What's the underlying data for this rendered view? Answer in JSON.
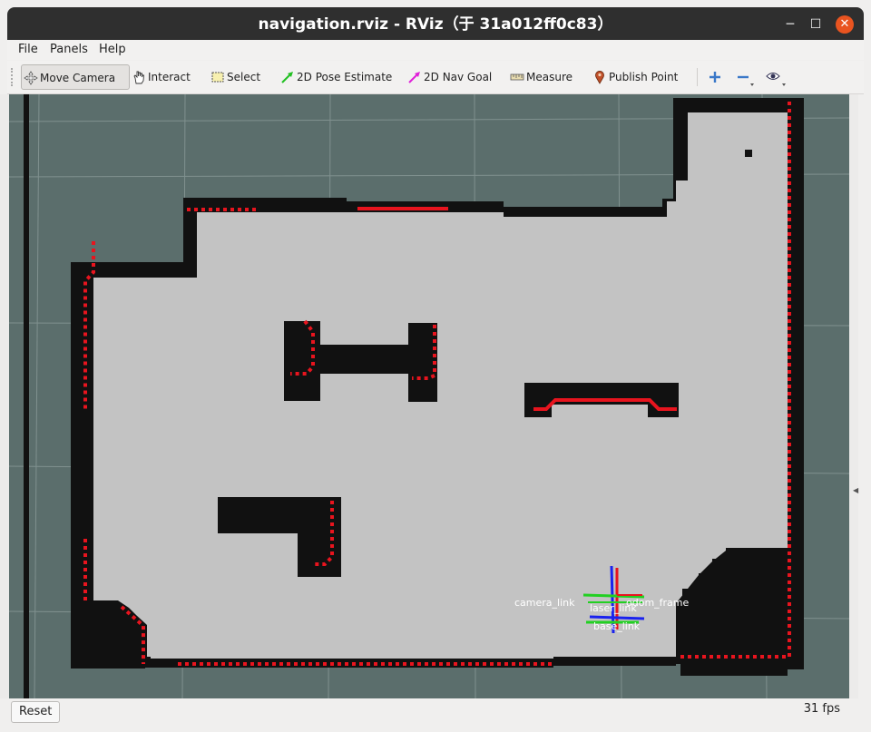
{
  "window": {
    "title": "navigation.rviz - RViz（于 31a012ff0c83）",
    "minimize_glyph": "─",
    "maximize_glyph": "☐",
    "close_glyph": "✕"
  },
  "menu": {
    "file": "File",
    "panels": "Panels",
    "help": "Help"
  },
  "toolbar": {
    "tools": [
      {
        "label": "Move Camera",
        "icon": "move-camera-icon",
        "active": true
      },
      {
        "label": "Interact",
        "icon": "hand-icon",
        "active": false
      },
      {
        "label": "Select",
        "icon": "select-box-icon",
        "active": false
      },
      {
        "label": "2D Pose Estimate",
        "icon": "green-arrow-icon",
        "active": false
      },
      {
        "label": "2D Nav Goal",
        "icon": "magenta-arrow-icon",
        "active": false
      },
      {
        "label": "Measure",
        "icon": "ruler-icon",
        "active": false
      },
      {
        "label": "Publish Point",
        "icon": "map-pin-icon",
        "active": false
      }
    ],
    "right_icons": [
      "plus-icon",
      "minus-icon",
      "eye-icon"
    ]
  },
  "viewport": {
    "frame_labels": {
      "left": "camera_link",
      "right": "odom_frame",
      "center": "laser_link",
      "bottom": "base_link"
    },
    "colors": {
      "background": "#5b6e6c",
      "free_space": "#c3c3c3",
      "obstacle": "#111111",
      "laser": "#e8141e"
    }
  },
  "status": {
    "reset": "Reset",
    "fps": "31 fps"
  }
}
